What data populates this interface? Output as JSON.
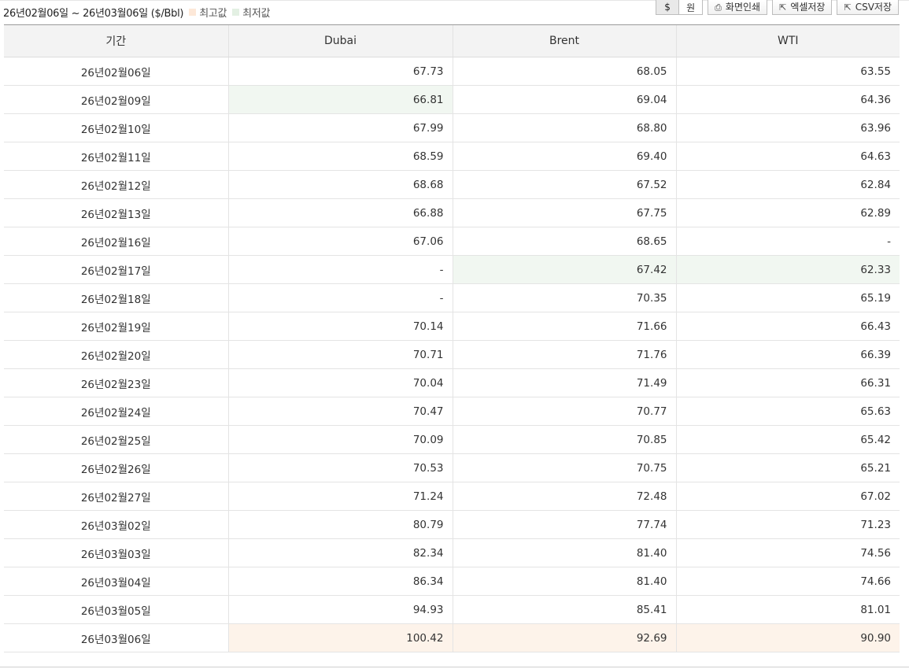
{
  "header": {
    "period_text": "26년02월06일 ~ 26년03월06일 ($/Bbl)",
    "legend_max_label": "최고값",
    "legend_min_label": "최저값",
    "legend_max_color": "#fde8d8",
    "legend_min_color": "#e3f0e3"
  },
  "toolbar": {
    "unit_dollar": "$",
    "unit_won": "원",
    "print_label": "화면인쇄",
    "excel_label": "엑셀저장",
    "csv_label": "CSV저장"
  },
  "table": {
    "columns": [
      "기간",
      "Dubai",
      "Brent",
      "WTI"
    ],
    "rows": [
      {
        "date": "26년02월06일",
        "dubai": "67.73",
        "brent": "68.05",
        "wti": "63.55"
      },
      {
        "date": "26년02월09일",
        "dubai": "66.81",
        "brent": "69.04",
        "wti": "64.36"
      },
      {
        "date": "26년02월10일",
        "dubai": "67.99",
        "brent": "68.80",
        "wti": "63.96"
      },
      {
        "date": "26년02월11일",
        "dubai": "68.59",
        "brent": "69.40",
        "wti": "64.63"
      },
      {
        "date": "26년02월12일",
        "dubai": "68.68",
        "brent": "67.52",
        "wti": "62.84"
      },
      {
        "date": "26년02월13일",
        "dubai": "66.88",
        "brent": "67.75",
        "wti": "62.89"
      },
      {
        "date": "26년02월16일",
        "dubai": "67.06",
        "brent": "68.65",
        "wti": "-"
      },
      {
        "date": "26년02월17일",
        "dubai": "-",
        "brent": "67.42",
        "wti": "62.33"
      },
      {
        "date": "26년02월18일",
        "dubai": "-",
        "brent": "70.35",
        "wti": "65.19"
      },
      {
        "date": "26년02월19일",
        "dubai": "70.14",
        "brent": "71.66",
        "wti": "66.43"
      },
      {
        "date": "26년02월20일",
        "dubai": "70.71",
        "brent": "71.76",
        "wti": "66.39"
      },
      {
        "date": "26년02월23일",
        "dubai": "70.04",
        "brent": "71.49",
        "wti": "66.31"
      },
      {
        "date": "26년02월24일",
        "dubai": "70.47",
        "brent": "70.77",
        "wti": "65.63"
      },
      {
        "date": "26년02월25일",
        "dubai": "70.09",
        "brent": "70.85",
        "wti": "65.42"
      },
      {
        "date": "26년02월26일",
        "dubai": "70.53",
        "brent": "70.75",
        "wti": "65.21"
      },
      {
        "date": "26년02월27일",
        "dubai": "71.24",
        "brent": "72.48",
        "wti": "67.02"
      },
      {
        "date": "26년03월02일",
        "dubai": "80.79",
        "brent": "77.74",
        "wti": "71.23"
      },
      {
        "date": "26년03월03일",
        "dubai": "82.34",
        "brent": "81.40",
        "wti": "74.56"
      },
      {
        "date": "26년03월04일",
        "dubai": "86.34",
        "brent": "81.40",
        "wti": "74.66"
      },
      {
        "date": "26년03월05일",
        "dubai": "94.93",
        "brent": "85.41",
        "wti": "81.01"
      },
      {
        "date": "26년03월06일",
        "dubai": "100.42",
        "brent": "92.69",
        "wti": "90.90"
      }
    ],
    "min_cells": [
      {
        "row": 1,
        "col": "dubai"
      },
      {
        "row": 7,
        "col": "brent"
      },
      {
        "row": 7,
        "col": "wti"
      }
    ],
    "max_cells": [
      {
        "row": 20,
        "col": "dubai"
      },
      {
        "row": 20,
        "col": "brent"
      },
      {
        "row": 20,
        "col": "wti"
      }
    ]
  }
}
